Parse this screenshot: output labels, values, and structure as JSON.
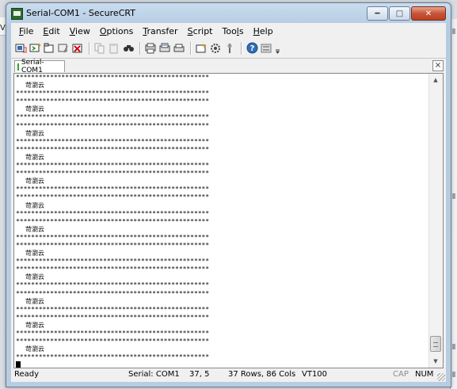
{
  "window": {
    "title": "Serial-COM1 - SecureCRT"
  },
  "background": {
    "left_text": "Vi"
  },
  "menu": [
    {
      "label": "File",
      "key": "F",
      "rest": "ile"
    },
    {
      "label": "Edit",
      "key": "E",
      "rest": "dit"
    },
    {
      "label": "View",
      "key": "V",
      "rest": "iew"
    },
    {
      "label": "Options",
      "key": "O",
      "rest": "ptions"
    },
    {
      "label": "Transfer",
      "key": "T",
      "rest": "ransfer"
    },
    {
      "label": "Script",
      "key": "S",
      "rest": "cript"
    },
    {
      "label": "Tools",
      "pre": "Too",
      "key": "l",
      "rest": "s"
    },
    {
      "label": "Help",
      "key": "H",
      "rest": "elp"
    }
  ],
  "toolbar": {
    "icons": [
      "connect-icon",
      "quick-connect-icon",
      "connect-in-tab-icon",
      "reconnect-icon",
      "disconnect-icon",
      "copy-icon",
      "paste-icon",
      "find-icon",
      "print-screen-icon",
      "print-selection-icon",
      "print-icon",
      "session-options-icon",
      "global-options-icon",
      "keymap-icon",
      "help-icon",
      "button-bar-icon",
      "overflow-icon"
    ],
    "accent": "#2f6db5"
  },
  "tab": {
    "label": "Serial-COM1",
    "status_color": "#2fa52f"
  },
  "terminal": {
    "lines": [
      "***************************************************",
      "苛瀏云",
      "***************************************************",
      "***************************************************",
      "苛瀏云",
      "***************************************************",
      "***************************************************",
      "苛瀏云",
      "***************************************************",
      "***************************************************",
      "苛瀏云",
      "***************************************************",
      "***************************************************",
      "苛瀏云",
      "***************************************************",
      "***************************************************",
      "苛瀏云",
      "***************************************************",
      "***************************************************",
      "苛瀏云",
      "***************************************************",
      "***************************************************",
      "苛瀏云",
      "***************************************************",
      "***************************************************",
      "苛瀏云",
      "***************************************************",
      "***************************************************",
      "苛瀏云",
      "***************************************************",
      "***************************************************",
      "苛瀏云",
      "***************************************************",
      "***************************************************",
      "苛瀏云",
      "***************************************************"
    ]
  },
  "status": {
    "ready": "Ready",
    "serial": "Serial: COM1",
    "position": "37,   5",
    "size": "37 Rows,  86 Cols",
    "emulation": "VT100",
    "cap": "CAP",
    "num": "NUM"
  }
}
